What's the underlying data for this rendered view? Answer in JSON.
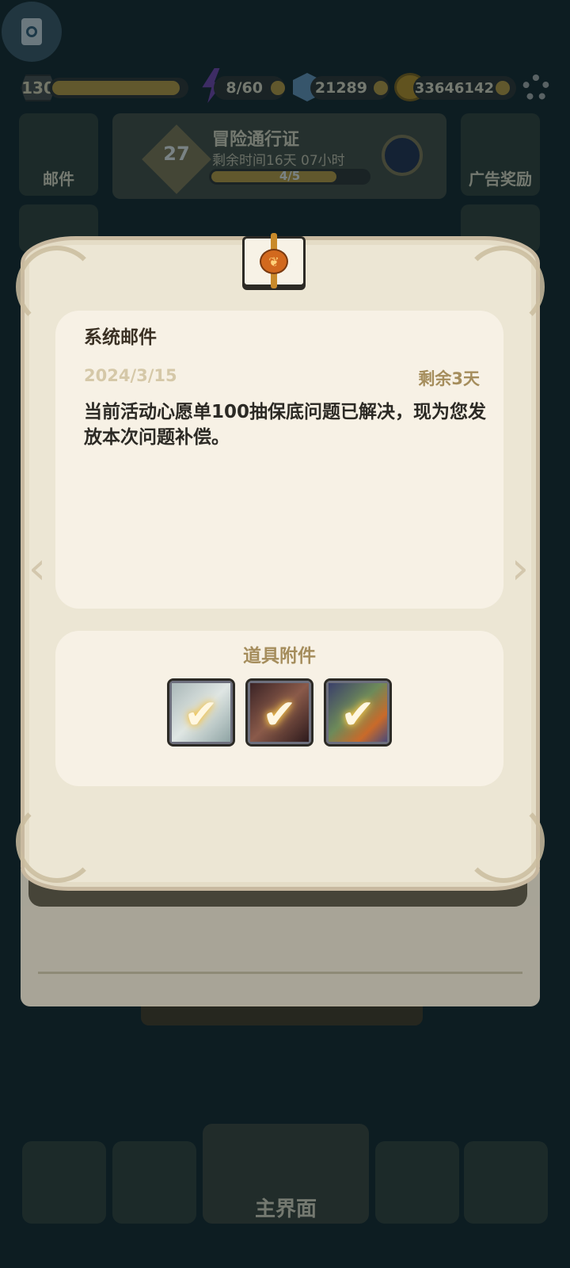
{
  "hud": {
    "level": "130",
    "energy": "8/60",
    "gems": "21289",
    "gold": "33646142",
    "mail_label": "邮件",
    "ad_reward_label": "广告奖励",
    "pass": {
      "title": "冒险通行证",
      "level": "27",
      "time_left": "剩余时间16天 07小时",
      "progress_text": "4/5",
      "progress": 0.8
    },
    "main_button_label": "主界面"
  },
  "mail": {
    "title": "系统邮件",
    "date": "2024/3/15",
    "remaining": "剩余3天",
    "body": "当前活动心愿单100抽保底问题已解决，现为您发放本次问题补偿。",
    "attachments_title": "道具附件",
    "attachments": [
      {
        "icon": "hero-portrait-icon",
        "claimed": true,
        "check": "✔"
      },
      {
        "icon": "hero-portrait-icon",
        "claimed": true,
        "check": "✔"
      },
      {
        "icon": "hero-portrait-icon",
        "claimed": true,
        "check": "✔"
      }
    ]
  },
  "icons": {
    "seal": "wax-seal-envelope-icon",
    "chevron_left": "‹",
    "chevron_right": "›",
    "wax_symbol": "❦"
  },
  "colors": {
    "paper": "#ece6d4",
    "card": "#f7f1e5",
    "accent_gold": "#a58d5c",
    "text_dark": "#2c2a25"
  }
}
